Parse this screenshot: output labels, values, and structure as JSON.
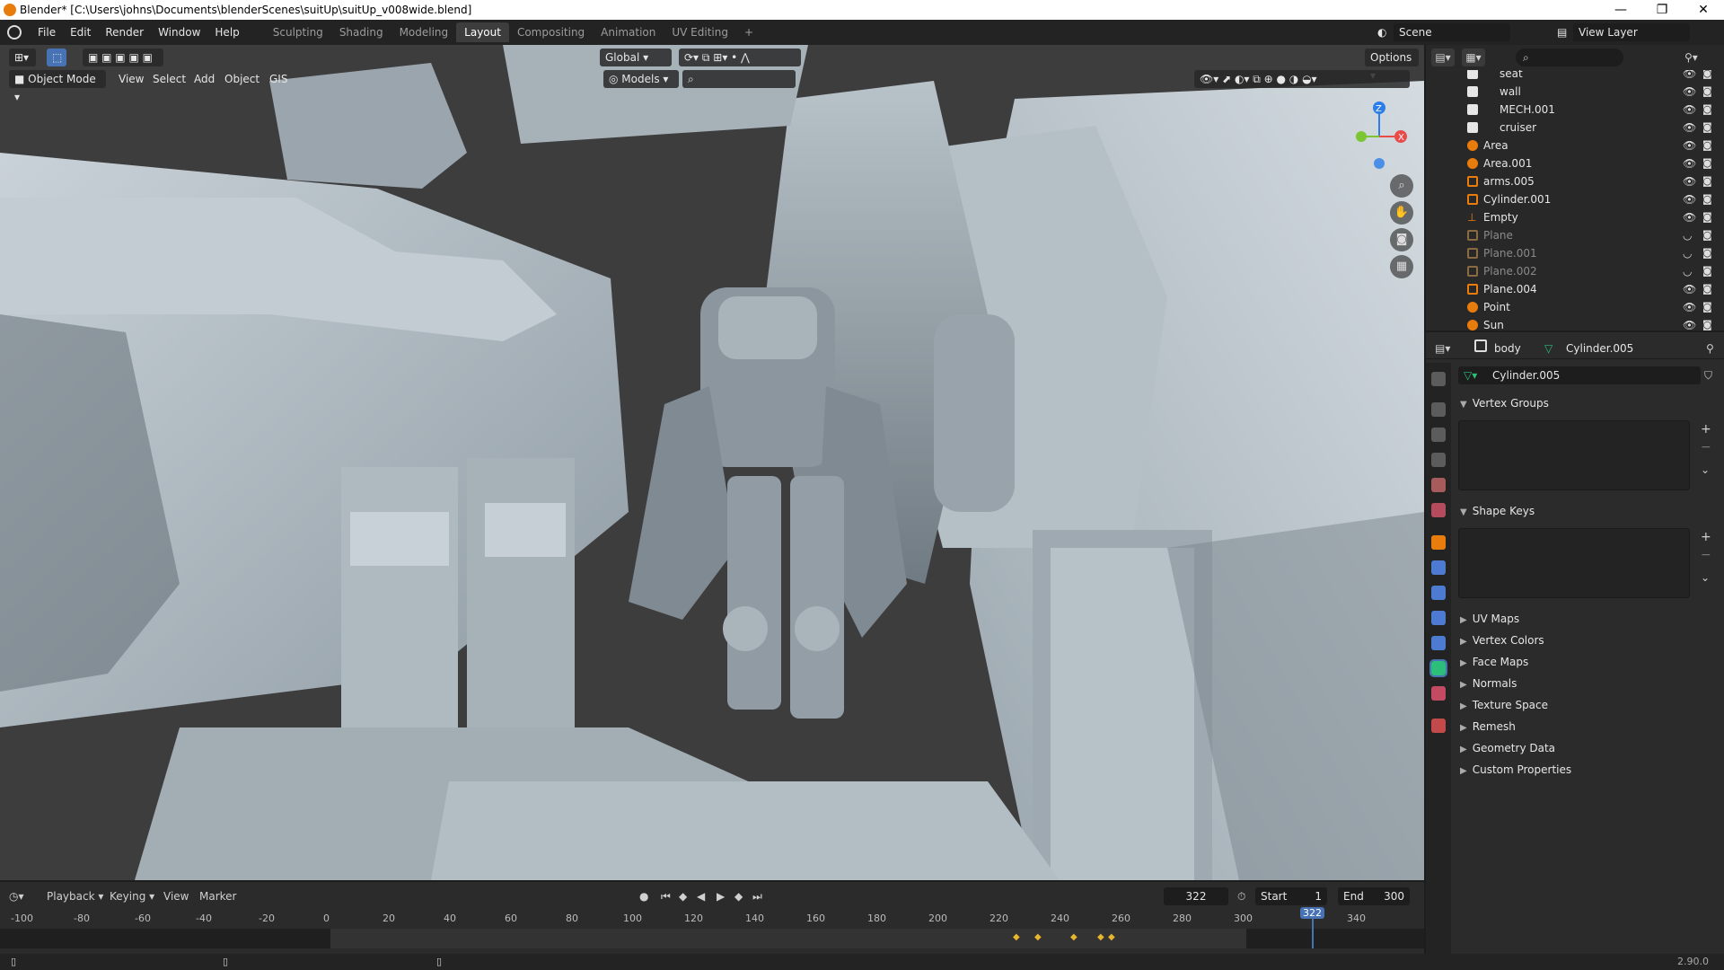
{
  "window": {
    "title": "Blender* [C:\\Users\\johns\\Documents\\blenderScenes\\suitUp\\suitUp_v008wide.blend]",
    "minimize": "—",
    "maximize": "❐",
    "close": "✕"
  },
  "menu": [
    "File",
    "Edit",
    "Render",
    "Window",
    "Help"
  ],
  "workspaces": [
    "Sculpting",
    "Shading",
    "Modeling",
    "Layout",
    "Compositing",
    "Animation",
    "UV Editing"
  ],
  "active_workspace": "Layout",
  "scene": {
    "name": "Scene",
    "view_layer": "View Layer"
  },
  "viewport": {
    "mode": "Object Mode",
    "menus": [
      "View",
      "Select",
      "Add",
      "Object",
      "GIS"
    ],
    "orientation": "Global",
    "collection_filter": "Models",
    "options_label": "Options",
    "axes": {
      "x": "X",
      "y": "Y",
      "z": "Z"
    }
  },
  "outliner": {
    "rows": [
      {
        "name": "seat",
        "type": "collection",
        "dim": false
      },
      {
        "name": "wall",
        "type": "collection",
        "dim": false
      },
      {
        "name": "MECH.001",
        "type": "collection",
        "dim": false
      },
      {
        "name": "cruiser",
        "type": "collection",
        "dim": false
      },
      {
        "name": "Area",
        "type": "light",
        "dim": false
      },
      {
        "name": "Area.001",
        "type": "light",
        "dim": false
      },
      {
        "name": "arms.005",
        "type": "mesh",
        "dim": false
      },
      {
        "name": "Cylinder.001",
        "type": "mesh",
        "dim": false
      },
      {
        "name": "Empty",
        "type": "empty",
        "dim": false
      },
      {
        "name": "Plane",
        "type": "mesh",
        "dim": true
      },
      {
        "name": "Plane.001",
        "type": "mesh",
        "dim": true
      },
      {
        "name": "Plane.002",
        "type": "mesh",
        "dim": true
      },
      {
        "name": "Plane.004",
        "type": "mesh",
        "dim": false
      },
      {
        "name": "Point",
        "type": "light",
        "dim": false
      },
      {
        "name": "Sun",
        "type": "light",
        "dim": false
      }
    ]
  },
  "properties": {
    "object": "body",
    "mesh": "Cylinder.005",
    "data_name": "Cylinder.005",
    "panels_open": [
      "Vertex Groups",
      "Shape Keys"
    ],
    "panels_closed": [
      "UV Maps",
      "Vertex Colors",
      "Face Maps",
      "Normals",
      "Texture Space",
      "Remesh",
      "Geometry Data",
      "Custom Properties"
    ]
  },
  "timeline": {
    "menus": [
      "Playback",
      "Keying",
      "View",
      "Marker"
    ],
    "current_frame": "322",
    "start_label": "Start",
    "start": "1",
    "end_label": "End",
    "end": "300",
    "ticks": [
      "-100",
      "-80",
      "-60",
      "-40",
      "-20",
      "0",
      "20",
      "40",
      "60",
      "80",
      "100",
      "120",
      "140",
      "160",
      "180",
      "200",
      "220",
      "240",
      "260",
      "280",
      "300",
      "320",
      "340"
    ]
  },
  "status": {
    "version": "2.90.0"
  },
  "colors": {
    "accent": "#4772b3",
    "object_orange": "#e87d0d",
    "mesh_green": "#2dbe7a",
    "keyframe": "#e8b52f"
  }
}
